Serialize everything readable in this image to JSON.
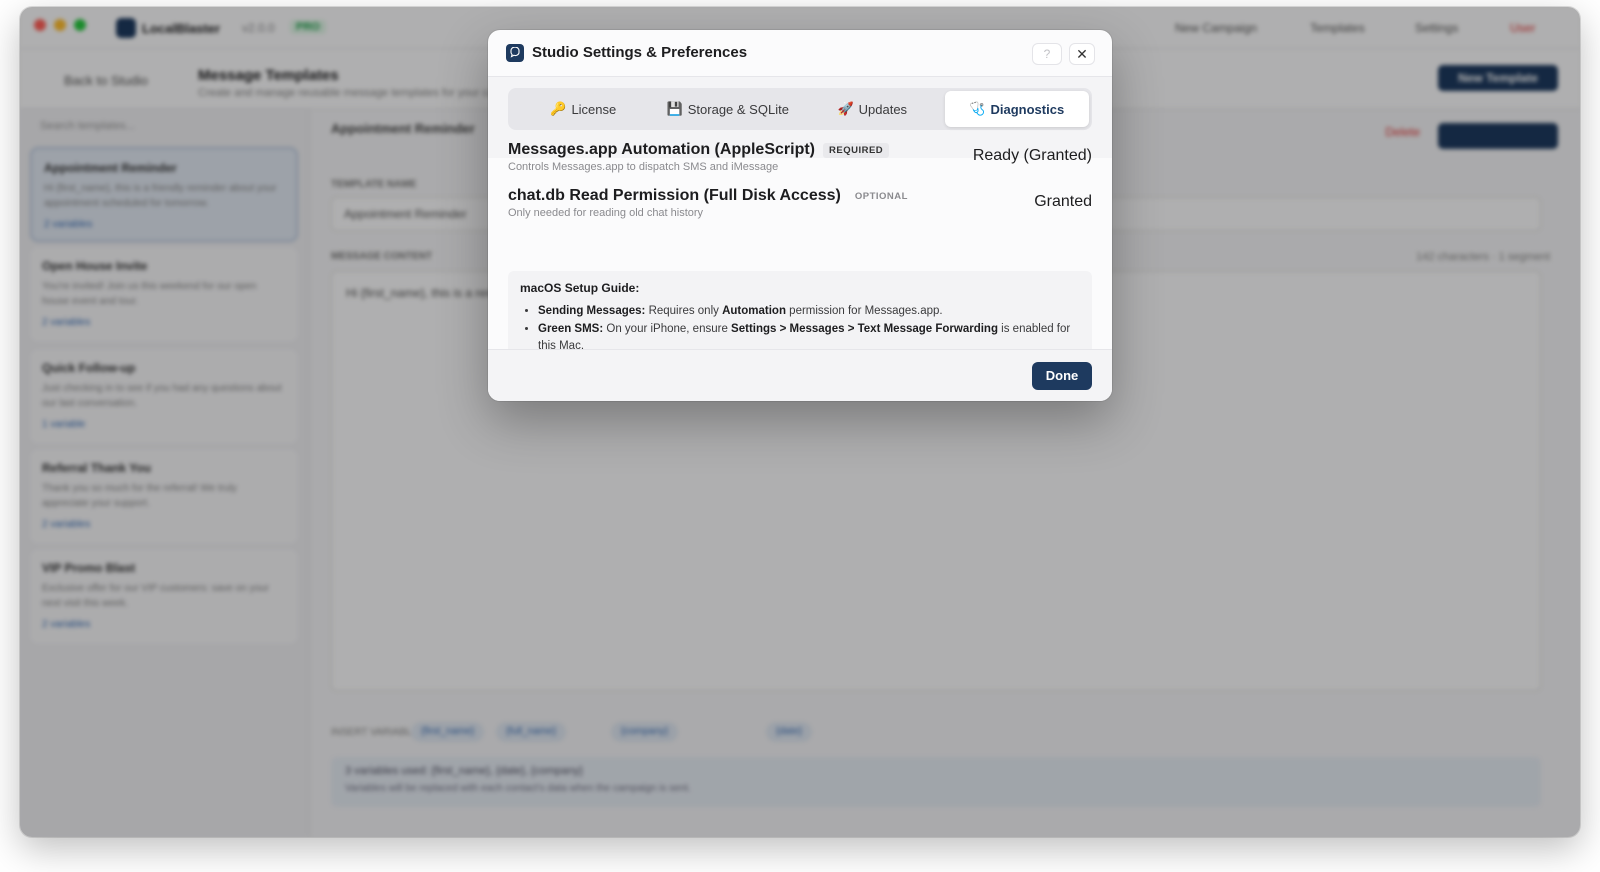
{
  "background_app": {
    "app_name": "LocalBlaster",
    "version": "v2.0.0",
    "badge": "PRO",
    "top_nav": [
      "New Campaign",
      "Templates",
      "Settings",
      "User"
    ],
    "back_label": "Back to Studio",
    "page_title": "Message Templates",
    "page_subtitle": "Create and manage reusable message templates for your campaigns",
    "new_template_label": "New Template",
    "search_placeholder": "Search templates...",
    "templates": [
      {
        "name": "Appointment Reminder",
        "desc": "Hi {first_name}, this is a friendly reminder about your appointment scheduled for tomorrow.",
        "tag": "2 variables"
      },
      {
        "name": "Open House Invite",
        "desc": "You're invited! Join us this weekend for our open house event and tour.",
        "tag": "2 variables"
      },
      {
        "name": "Quick Follow-up",
        "desc": "Just checking in to see if you had any questions about our last conversation.",
        "tag": "1 variable"
      },
      {
        "name": "Referral Thank You",
        "desc": "Thank you so much for the referral! We truly appreciate your support.",
        "tag": "2 variables"
      },
      {
        "name": "VIP Promo Blast",
        "desc": "Exclusive offer for our VIP customers: save on your next visit this week.",
        "tag": "2 variables"
      }
    ],
    "editor_title": "Appointment Reminder",
    "template_name_label": "TEMPLATE NAME",
    "template_name_value": "Appointment Reminder",
    "message_label": "MESSAGE CONTENT",
    "message_value": "Hi {first_name}, this is a reminder...",
    "char_count": "142 characters · 1 segment",
    "delete_label": "Delete",
    "save_label": "Save Template",
    "insert_label": "INSERT VARIABLE",
    "variable_chips": [
      "{first_name}",
      "{full_name}",
      "{company}",
      "{date}"
    ],
    "info_title": "3 variables used: {first_name}, {date}, {company}",
    "info_body": "Variables will be replaced with each contact's data when the campaign is sent."
  },
  "modal": {
    "title": "Studio Settings & Preferences",
    "help_label": "?",
    "close_label": "✕",
    "tabs": [
      {
        "icon": "🔑",
        "label": "License"
      },
      {
        "icon": "💾",
        "label": "Storage & SQLite"
      },
      {
        "icon": "🚀",
        "label": "Updates"
      },
      {
        "icon": "🩺",
        "label": "Diagnostics"
      }
    ],
    "active_tab": "Diagnostics",
    "permissions": [
      {
        "title": "Messages.app Automation (AppleScript)",
        "badge": "REQUIRED",
        "desc": "Controls Messages.app to dispatch SMS and iMessage",
        "status": "Ready (Granted)"
      },
      {
        "title": "chat.db Read Permission (Full Disk Access)",
        "badge": "OPTIONAL",
        "desc": "Only needed for reading old chat history",
        "status": "Granted"
      }
    ],
    "guide": {
      "title": "macOS Setup Guide:",
      "item1": {
        "lead": "Sending Messages:",
        "t1": " Requires only ",
        "b1": "Automation",
        "t2": " permission for Messages.app."
      },
      "item2": {
        "lead": "Green SMS:",
        "t1": " On your iPhone, ensure ",
        "b1": "Settings > Messages > Text Message Forwarding",
        "t2": " is enabled for this Mac."
      }
    },
    "done_label": "Done"
  },
  "colors": {
    "accent": "#1e3a5f",
    "active_tab_text": "#1e3a5f"
  }
}
